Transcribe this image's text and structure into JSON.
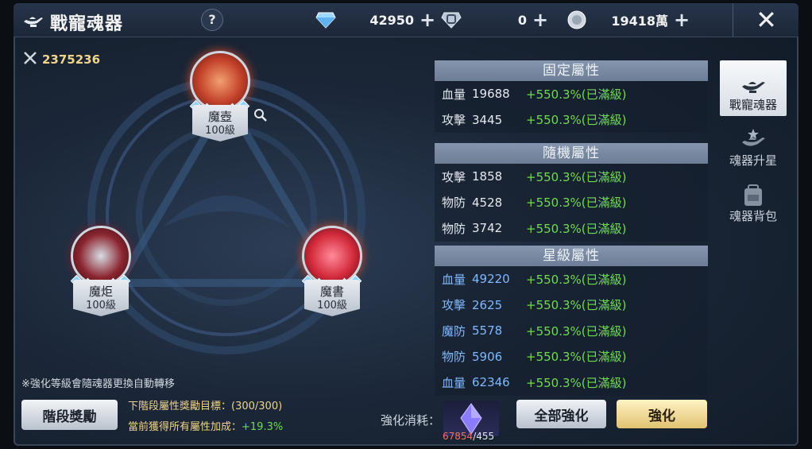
{
  "app": {
    "title": "戰寵魂器"
  },
  "header": {
    "help_label": "?",
    "currencies": [
      {
        "icon": "diamond-icon",
        "value": "42950"
      },
      {
        "icon": "bound-diamond-icon",
        "value": "0"
      },
      {
        "icon": "silver-coin-icon",
        "value": "19418萬"
      }
    ],
    "plus_label": "+",
    "close_label": "✕"
  },
  "power": {
    "icon": "crossed-swords-icon",
    "value": "2375236"
  },
  "slots": [
    {
      "name": "魔壺",
      "level": "100級",
      "color": "#c2402a"
    },
    {
      "name": "魔炬",
      "level": "100級",
      "color": "#8c2530"
    },
    {
      "name": "魔書",
      "level": "100級",
      "color": "#d32a3a"
    }
  ],
  "note": "※強化等級會隨魂器更換自動轉移",
  "stage_button": "階段獎勵",
  "goal": {
    "label": "下階段屬性獎勵目標：",
    "value": "(300/300)"
  },
  "gained": {
    "label": "當前獲得所有屬性加成：",
    "value": "+19.3%"
  },
  "cost": {
    "label": "強化消耗：",
    "have": "67854",
    "need": "/455"
  },
  "buttons": {
    "all": "全部強化",
    "enhance": "強化"
  },
  "fixed": {
    "title": "固定屬性",
    "rows": [
      {
        "k": "血量",
        "v": "19688",
        "b": "+550.3%(已滿級)"
      },
      {
        "k": "攻擊",
        "v": "3445",
        "b": "+550.3%(已滿級)"
      }
    ]
  },
  "random": {
    "title": "隨機屬性",
    "rows": [
      {
        "k": "攻擊",
        "v": "1858",
        "b": "+550.3%(已滿級)"
      },
      {
        "k": "物防",
        "v": "4528",
        "b": "+550.3%(已滿級)"
      },
      {
        "k": "物防",
        "v": "3742",
        "b": "+550.3%(已滿級)"
      }
    ]
  },
  "star": {
    "title": "星級屬性",
    "rows": [
      {
        "k": "血量",
        "v": "49220",
        "b": "+550.3%(已滿級)"
      },
      {
        "k": "攻擊",
        "v": "2625",
        "b": "+550.3%(已滿級)"
      },
      {
        "k": "魔防",
        "v": "5578",
        "b": "+550.3%(已滿級)"
      },
      {
        "k": "物防",
        "v": "5906",
        "b": "+550.3%(已滿級)"
      },
      {
        "k": "血量",
        "v": "62346",
        "b": "+550.3%(已滿級)"
      }
    ]
  },
  "tabs": [
    {
      "label": "戰寵魂器",
      "icon": "magic-lamp-icon"
    },
    {
      "label": "魂器升星",
      "icon": "star-lamp-icon"
    },
    {
      "label": "魂器背包",
      "icon": "backpack-icon"
    }
  ]
}
